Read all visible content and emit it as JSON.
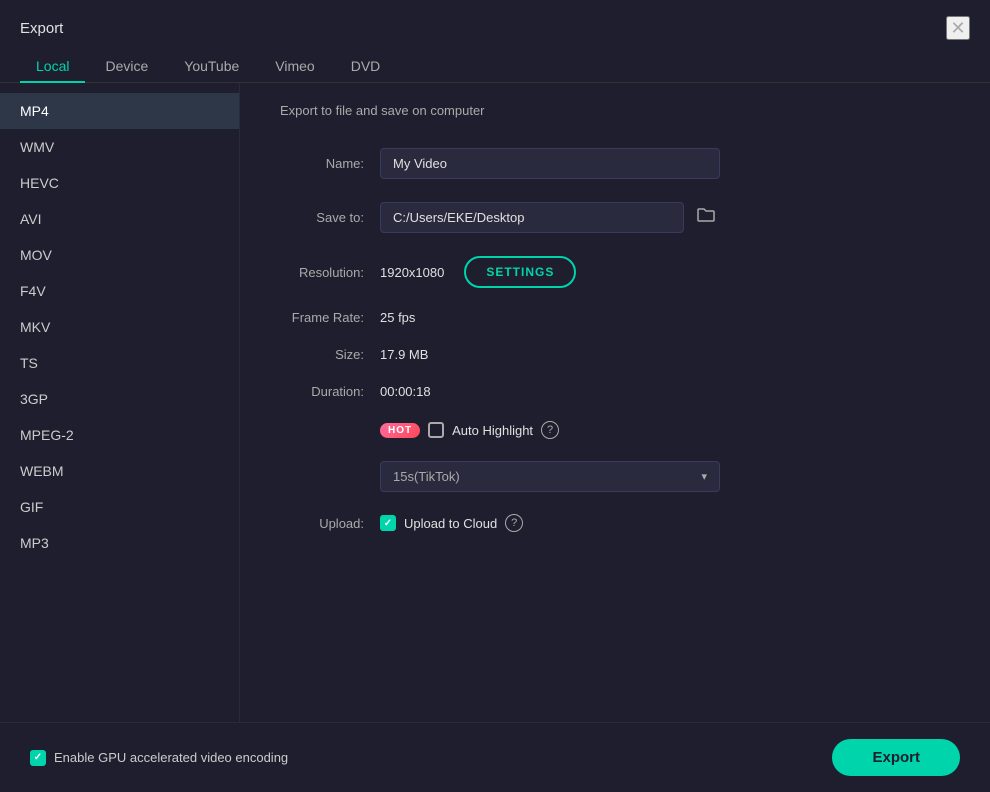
{
  "dialog": {
    "title": "Export"
  },
  "tabs": [
    {
      "id": "local",
      "label": "Local",
      "active": true
    },
    {
      "id": "device",
      "label": "Device",
      "active": false
    },
    {
      "id": "youtube",
      "label": "YouTube",
      "active": false
    },
    {
      "id": "vimeo",
      "label": "Vimeo",
      "active": false
    },
    {
      "id": "dvd",
      "label": "DVD",
      "active": false
    }
  ],
  "sidebar": {
    "items": [
      {
        "id": "mp4",
        "label": "MP4",
        "active": true
      },
      {
        "id": "wmv",
        "label": "WMV",
        "active": false
      },
      {
        "id": "hevc",
        "label": "HEVC",
        "active": false
      },
      {
        "id": "avi",
        "label": "AVI",
        "active": false
      },
      {
        "id": "mov",
        "label": "MOV",
        "active": false
      },
      {
        "id": "f4v",
        "label": "F4V",
        "active": false
      },
      {
        "id": "mkv",
        "label": "MKV",
        "active": false
      },
      {
        "id": "ts",
        "label": "TS",
        "active": false
      },
      {
        "id": "3gp",
        "label": "3GP",
        "active": false
      },
      {
        "id": "mpeg2",
        "label": "MPEG-2",
        "active": false
      },
      {
        "id": "webm",
        "label": "WEBM",
        "active": false
      },
      {
        "id": "gif",
        "label": "GIF",
        "active": false
      },
      {
        "id": "mp3",
        "label": "MP3",
        "active": false
      }
    ]
  },
  "form": {
    "description": "Export to file and save on computer",
    "name_label": "Name:",
    "name_value": "My Video",
    "save_to_label": "Save to:",
    "save_to_value": "C:/Users/EKE/Desktop",
    "resolution_label": "Resolution:",
    "resolution_value": "1920x1080",
    "settings_btn_label": "SETTINGS",
    "frame_rate_label": "Frame Rate:",
    "frame_rate_value": "25 fps",
    "size_label": "Size:",
    "size_value": "17.9 MB",
    "duration_label": "Duration:",
    "duration_value": "00:00:18",
    "hot_badge": "HOT",
    "auto_highlight_label": "Auto Highlight",
    "tiktok_option": "15s(TikTok)",
    "upload_label": "Upload:",
    "upload_to_cloud_label": "Upload to Cloud"
  },
  "bottom": {
    "gpu_label": "Enable GPU accelerated video encoding",
    "export_btn_label": "Export"
  },
  "icons": {
    "close": "✕",
    "folder": "🗀",
    "chevron_down": "▾",
    "check": "✓",
    "help": "?"
  }
}
